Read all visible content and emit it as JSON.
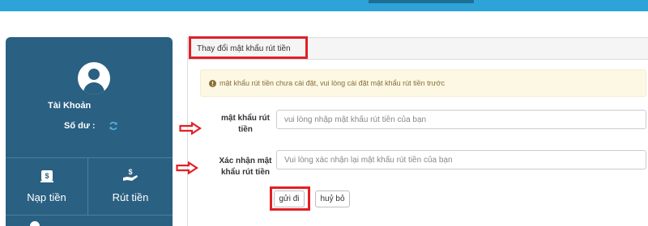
{
  "account": {
    "account_label": "Tài Khoản",
    "balance_label": "Số dư :"
  },
  "actions": {
    "deposit_label": "Nạp tiền",
    "withdraw_label": "Rút tiền"
  },
  "panel": {
    "title": "Thay đổi mật khẩu rút tiền",
    "warning": "mật khẩu rút tiền chưa cài đặt, vui lòng cài đặt mật khẩu rút tiền trước"
  },
  "form": {
    "password_label_line1": "mật khẩu rút",
    "password_label_line2": "tiền",
    "password_placeholder": "vui lòng nhập mật khẩu rút tiền của bạn",
    "confirm_label_line1": "Xác nhận mật",
    "confirm_label_line2": "khẩu rút tiền",
    "confirm_placeholder": "Vui lòng xác nhận lại mật khẩu rút tiền của bạn",
    "submit_label": "gửi đi",
    "cancel_label": "huỷ bỏ"
  },
  "colors": {
    "top_bar": "#2ea3d8",
    "account_panel": "#2a6082",
    "annotation_red": "#e21f26",
    "warning_bg": "#fcf8e3",
    "warning_text": "#8a6d3b"
  },
  "icons": {
    "avatar": "user-avatar-icon",
    "refresh": "refresh-icon",
    "deposit": "money-bag-icon",
    "withdraw": "hand-money-icon",
    "warning": "exclamation-circle-icon",
    "annotation_arrow": "right-arrow-icon"
  }
}
